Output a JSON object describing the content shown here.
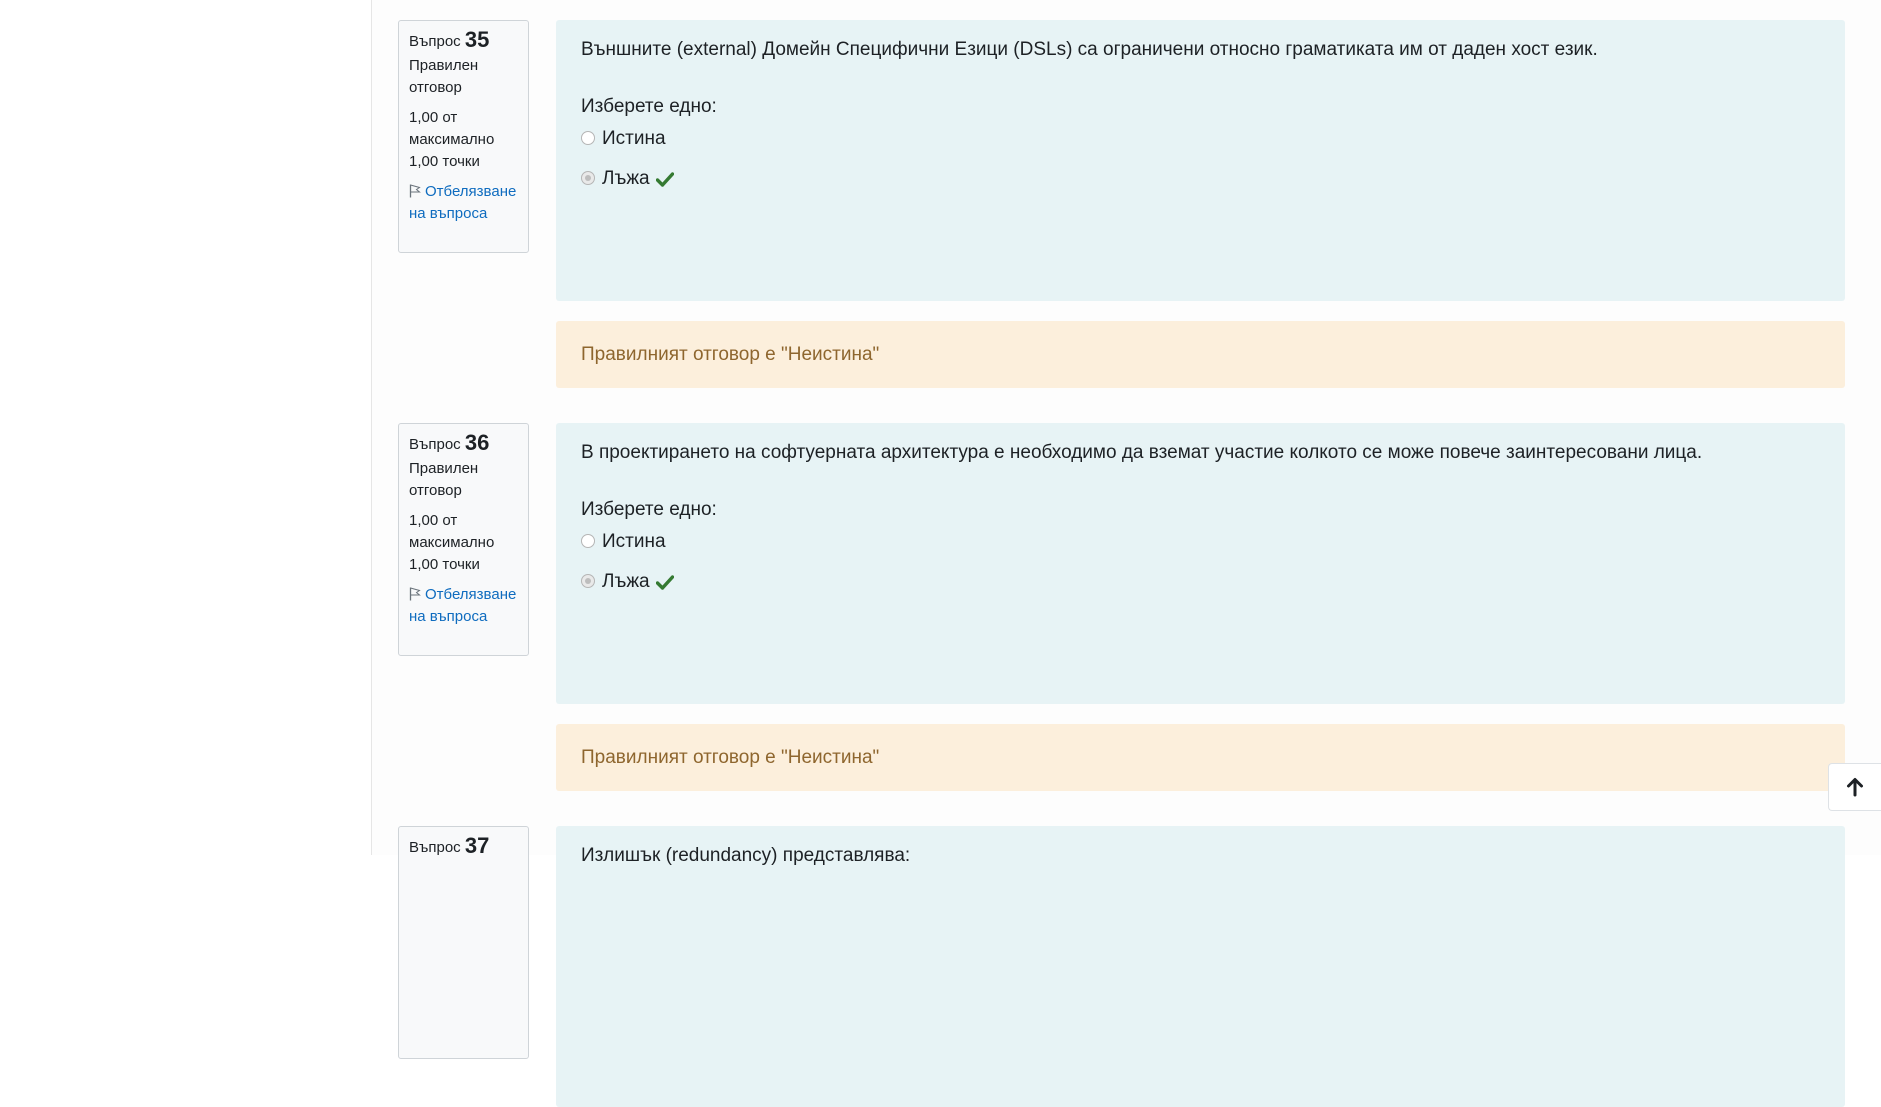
{
  "questions": [
    {
      "label": "Въпрос",
      "number": "35",
      "state": "Правилен отговор",
      "grade": "1,00 от максимално 1,00 точки",
      "flag": "Отбелязване на въпроса",
      "text": "Външните (external) Домейн Специфични Езици (DSLs) са ограничени относно граматиката им от даден хост език.",
      "prompt": "Изберете едно:",
      "options": [
        {
          "label": "Истина",
          "selected": false,
          "correct": false
        },
        {
          "label": "Лъжа",
          "selected": true,
          "correct": true
        }
      ],
      "feedback": "Правилният отговор е \"Неистина\""
    },
    {
      "label": "Въпрос",
      "number": "36",
      "state": "Правилен отговор",
      "grade": "1,00 от максимално 1,00 точки",
      "flag": "Отбелязване на въпроса",
      "text": "В проектирането на софтуерната архитектура е необходимо да вземат участие колкото се може повече заинтересовани лица.",
      "prompt": "Изберете едно:",
      "options": [
        {
          "label": "Истина",
          "selected": false,
          "correct": false
        },
        {
          "label": "Лъжа",
          "selected": true,
          "correct": true
        }
      ],
      "feedback": "Правилният отговор е \"Неистина\""
    },
    {
      "label": "Въпрос",
      "number": "37",
      "text": "Излишък (redundancy) представлява:"
    }
  ],
  "icons": {
    "flag": "flag-icon",
    "check": "check-icon",
    "back_to_top": "arrow-up-icon"
  },
  "colors": {
    "formulation_bg": "#e7f3f5",
    "feedback_bg": "#fcefdc",
    "feedback_text": "#8e662e",
    "link": "#0f6cbf",
    "correct": "#357a32"
  }
}
